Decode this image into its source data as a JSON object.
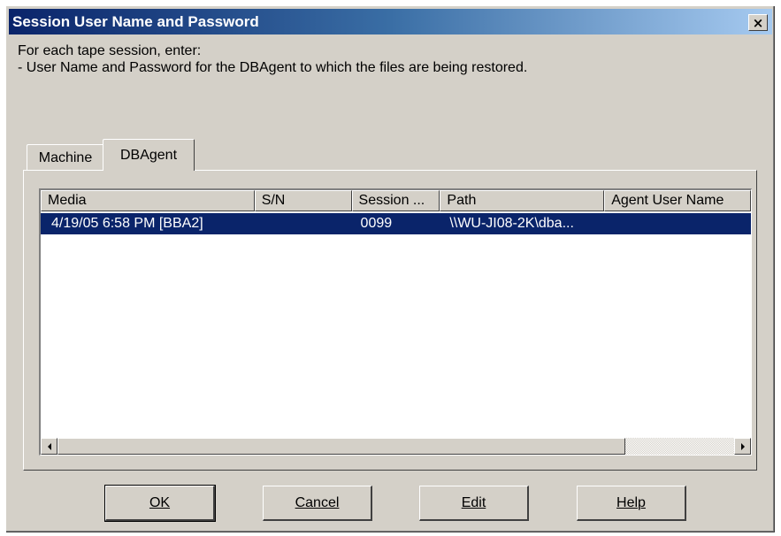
{
  "window": {
    "title": "Session User Name and Password",
    "close_label": "×"
  },
  "instructions": {
    "line1": "For each tape session, enter:",
    "line2": "- User Name and Password for the DBAgent to which the files are being restored."
  },
  "tabs": [
    {
      "label": "Machine",
      "active": false
    },
    {
      "label": "DBAgent",
      "active": true
    }
  ],
  "table": {
    "columns": [
      "Media",
      "S/N",
      "Session ...",
      "Path",
      "Agent User Name"
    ],
    "rows": [
      {
        "media": "4/19/05 6:58 PM [BBA2]",
        "sn": "",
        "session": "0099",
        "path": "\\\\WU-JI08-2K\\dba...",
        "agent_user": "",
        "selected": true
      }
    ]
  },
  "buttons": {
    "ok": "OK",
    "cancel": "Cancel",
    "edit": "Edit",
    "help": "Help"
  },
  "icons": {
    "scroll_left": "triangle-left-icon",
    "scroll_right": "triangle-right-icon",
    "close": "close-icon"
  }
}
